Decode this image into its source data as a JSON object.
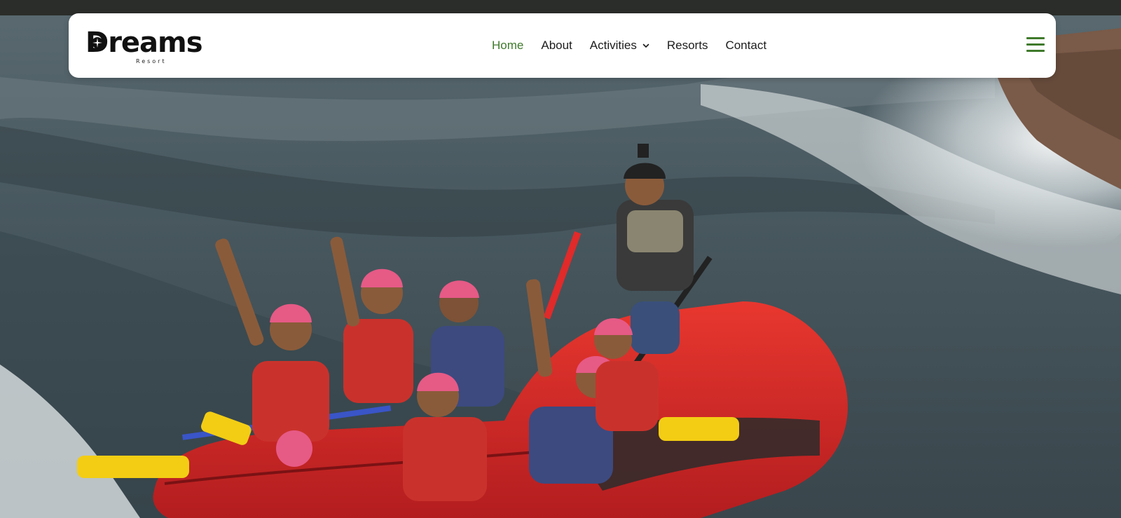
{
  "brand": {
    "name": "Dreams",
    "subtitle": "Resort"
  },
  "nav": {
    "items": [
      {
        "label": "Home",
        "active": true,
        "icon": null
      },
      {
        "label": "About",
        "active": false,
        "icon": null
      },
      {
        "label": "Activities",
        "active": false,
        "icon": "chevron-down-icon"
      },
      {
        "label": "Resorts",
        "active": false,
        "icon": null
      },
      {
        "label": "Contact",
        "active": false,
        "icon": null
      }
    ],
    "menu_icon": "hamburger-menu-icon"
  },
  "hero": {
    "scene": "whitewater-rafting-photo"
  },
  "colors": {
    "accent": "#3f7a2b",
    "nav_text": "#1c1c1c",
    "navbar_bg": "#ffffff",
    "raft_red": "#d7262a",
    "helmet_pink": "#e65a86",
    "water_dark": "#3c4a50"
  }
}
